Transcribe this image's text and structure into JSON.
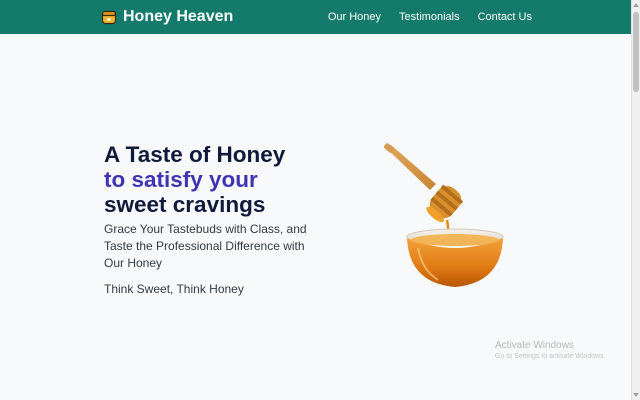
{
  "navbar": {
    "brand": "Honey Heaven",
    "logo_icon": "honey-pot-icon",
    "links": [
      "Our Honey",
      "Testimonials",
      "Contact Us"
    ],
    "background": "#147a6c"
  },
  "hero": {
    "title_line1": "A Taste of Honey",
    "title_line2": "to satisfy your",
    "title_line3": "sweet cravings",
    "description": "Grace Your Tastebuds with Class, and Taste the Professional Difference with Our Honey",
    "slogan": "Think Sweet, Think Honey",
    "accent_color": "#4034b6",
    "image_icon": "honey-dipper-bowl-icon"
  },
  "watermark": {
    "title": "Activate Windows",
    "subtitle": "Go to Settings to activate Windows."
  }
}
